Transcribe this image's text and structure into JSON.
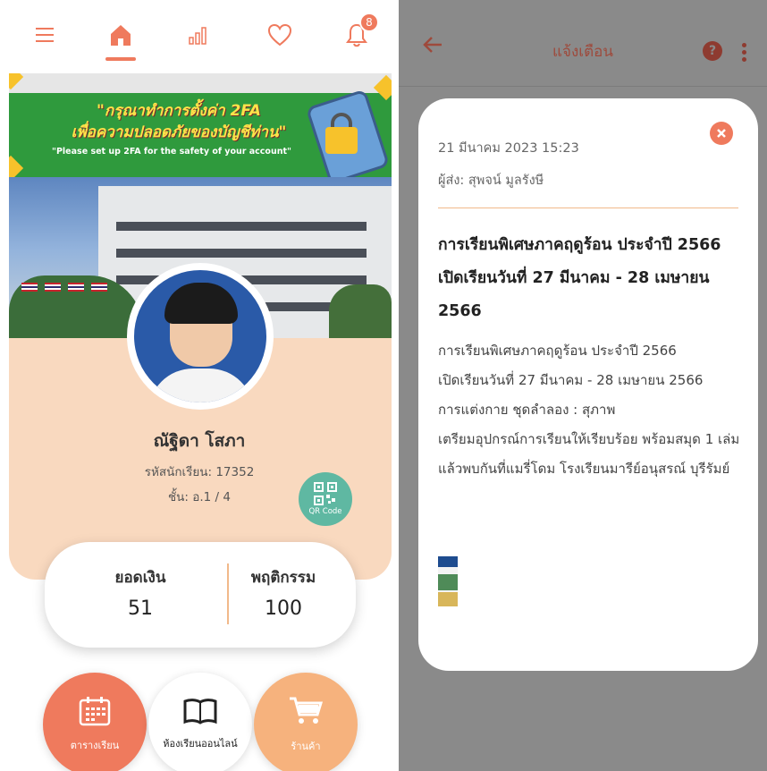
{
  "left": {
    "banner": {
      "line1": "\"กรุณาทำการตั้งค่า 2FA",
      "line2": "เพื่อความปลอดภัยของบัญชีท่าน\"",
      "line3": "\"Please set up 2FA for the safety of your account\""
    },
    "nav": {
      "notification_count": "8"
    },
    "student": {
      "name": "ณัฐิดา โสภา",
      "id_line": "รหัสนักเรียน: 17352",
      "class_line": "ชั้น: อ.1 / 4"
    },
    "qr": {
      "label": "QR Code"
    },
    "stats": {
      "balance_label": "ยอดเงิน",
      "balance_value": "51",
      "behavior_label": "พฤติกรรม",
      "behavior_value": "100"
    },
    "actions": {
      "schedule": "ตารางเรียน",
      "online_class": "ห้องเรียนออนไลน์",
      "shop": "ร้านค้า"
    }
  },
  "right": {
    "title": "แจ้งเตือน",
    "help_glyph": "?",
    "message": {
      "date": "21 มีนาคม 2023 15:23",
      "sender": "ผู้ส่ง: สุพจน์ มูลรังษี",
      "title": "การเรียนพิเศษภาคฤดูร้อน ประจำปี 2566 เปิดเรียนวันที่ 27 มีนาคม - 28 เมษายน 2566",
      "body_lines": [
        "การเรียนพิเศษภาคฤดูร้อน ประจำปี 2566",
        "เปิดเรียนวันที่ 27 มีนาคม - 28 เมษายน 2566",
        "การแต่งกาย ชุดลำลอง : สุภาพ",
        "เตรียมอุปกรณ์การเรียนให้เรียบร้อย พร้อมสมุด 1 เล่ม",
        "แล้วพบกันที่แมรี่โดม โรงเรียนมารีย์อนุสรณ์ บุรีรัมย์"
      ]
    }
  },
  "colors": {
    "accent": "#ef7a5d",
    "peach": "#f9d9bf",
    "teal": "#5fb8a2",
    "overlay_gray": "#8a8a8a",
    "shop_orange": "#f6b27d"
  }
}
